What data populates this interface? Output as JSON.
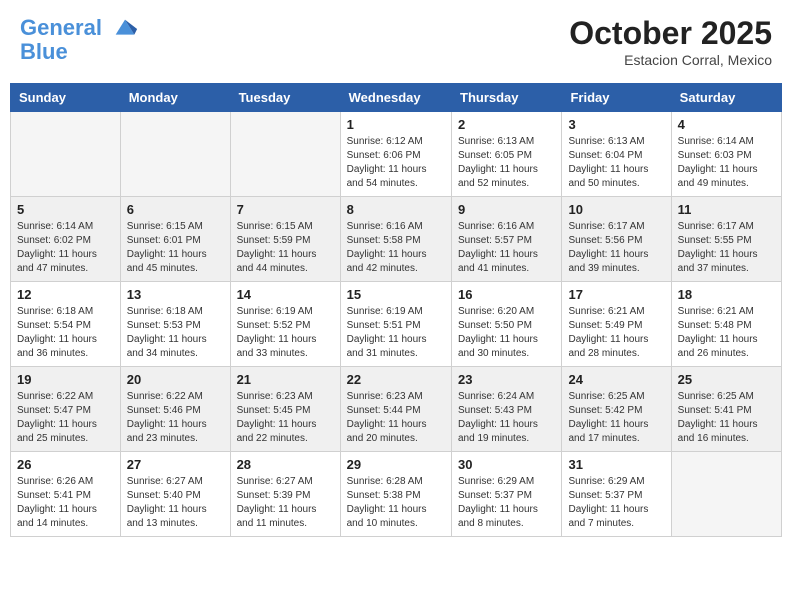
{
  "header": {
    "logo_line1": "General",
    "logo_line2": "Blue",
    "month_title": "October 2025",
    "location": "Estacion Corral, Mexico"
  },
  "weekdays": [
    "Sunday",
    "Monday",
    "Tuesday",
    "Wednesday",
    "Thursday",
    "Friday",
    "Saturday"
  ],
  "weeks": [
    [
      {
        "day": "",
        "sunrise": "",
        "sunset": "",
        "daylight": ""
      },
      {
        "day": "",
        "sunrise": "",
        "sunset": "",
        "daylight": ""
      },
      {
        "day": "",
        "sunrise": "",
        "sunset": "",
        "daylight": ""
      },
      {
        "day": "1",
        "sunrise": "6:12 AM",
        "sunset": "6:06 PM",
        "daylight": "11 hours and 54 minutes."
      },
      {
        "day": "2",
        "sunrise": "6:13 AM",
        "sunset": "6:05 PM",
        "daylight": "11 hours and 52 minutes."
      },
      {
        "day": "3",
        "sunrise": "6:13 AM",
        "sunset": "6:04 PM",
        "daylight": "11 hours and 50 minutes."
      },
      {
        "day": "4",
        "sunrise": "6:14 AM",
        "sunset": "6:03 PM",
        "daylight": "11 hours and 49 minutes."
      }
    ],
    [
      {
        "day": "5",
        "sunrise": "6:14 AM",
        "sunset": "6:02 PM",
        "daylight": "11 hours and 47 minutes."
      },
      {
        "day": "6",
        "sunrise": "6:15 AM",
        "sunset": "6:01 PM",
        "daylight": "11 hours and 45 minutes."
      },
      {
        "day": "7",
        "sunrise": "6:15 AM",
        "sunset": "5:59 PM",
        "daylight": "11 hours and 44 minutes."
      },
      {
        "day": "8",
        "sunrise": "6:16 AM",
        "sunset": "5:58 PM",
        "daylight": "11 hours and 42 minutes."
      },
      {
        "day": "9",
        "sunrise": "6:16 AM",
        "sunset": "5:57 PM",
        "daylight": "11 hours and 41 minutes."
      },
      {
        "day": "10",
        "sunrise": "6:17 AM",
        "sunset": "5:56 PM",
        "daylight": "11 hours and 39 minutes."
      },
      {
        "day": "11",
        "sunrise": "6:17 AM",
        "sunset": "5:55 PM",
        "daylight": "11 hours and 37 minutes."
      }
    ],
    [
      {
        "day": "12",
        "sunrise": "6:18 AM",
        "sunset": "5:54 PM",
        "daylight": "11 hours and 36 minutes."
      },
      {
        "day": "13",
        "sunrise": "6:18 AM",
        "sunset": "5:53 PM",
        "daylight": "11 hours and 34 minutes."
      },
      {
        "day": "14",
        "sunrise": "6:19 AM",
        "sunset": "5:52 PM",
        "daylight": "11 hours and 33 minutes."
      },
      {
        "day": "15",
        "sunrise": "6:19 AM",
        "sunset": "5:51 PM",
        "daylight": "11 hours and 31 minutes."
      },
      {
        "day": "16",
        "sunrise": "6:20 AM",
        "sunset": "5:50 PM",
        "daylight": "11 hours and 30 minutes."
      },
      {
        "day": "17",
        "sunrise": "6:21 AM",
        "sunset": "5:49 PM",
        "daylight": "11 hours and 28 minutes."
      },
      {
        "day": "18",
        "sunrise": "6:21 AM",
        "sunset": "5:48 PM",
        "daylight": "11 hours and 26 minutes."
      }
    ],
    [
      {
        "day": "19",
        "sunrise": "6:22 AM",
        "sunset": "5:47 PM",
        "daylight": "11 hours and 25 minutes."
      },
      {
        "day": "20",
        "sunrise": "6:22 AM",
        "sunset": "5:46 PM",
        "daylight": "11 hours and 23 minutes."
      },
      {
        "day": "21",
        "sunrise": "6:23 AM",
        "sunset": "5:45 PM",
        "daylight": "11 hours and 22 minutes."
      },
      {
        "day": "22",
        "sunrise": "6:23 AM",
        "sunset": "5:44 PM",
        "daylight": "11 hours and 20 minutes."
      },
      {
        "day": "23",
        "sunrise": "6:24 AM",
        "sunset": "5:43 PM",
        "daylight": "11 hours and 19 minutes."
      },
      {
        "day": "24",
        "sunrise": "6:25 AM",
        "sunset": "5:42 PM",
        "daylight": "11 hours and 17 minutes."
      },
      {
        "day": "25",
        "sunrise": "6:25 AM",
        "sunset": "5:41 PM",
        "daylight": "11 hours and 16 minutes."
      }
    ],
    [
      {
        "day": "26",
        "sunrise": "6:26 AM",
        "sunset": "5:41 PM",
        "daylight": "11 hours and 14 minutes."
      },
      {
        "day": "27",
        "sunrise": "6:27 AM",
        "sunset": "5:40 PM",
        "daylight": "11 hours and 13 minutes."
      },
      {
        "day": "28",
        "sunrise": "6:27 AM",
        "sunset": "5:39 PM",
        "daylight": "11 hours and 11 minutes."
      },
      {
        "day": "29",
        "sunrise": "6:28 AM",
        "sunset": "5:38 PM",
        "daylight": "11 hours and 10 minutes."
      },
      {
        "day": "30",
        "sunrise": "6:29 AM",
        "sunset": "5:37 PM",
        "daylight": "11 hours and 8 minutes."
      },
      {
        "day": "31",
        "sunrise": "6:29 AM",
        "sunset": "5:37 PM",
        "daylight": "11 hours and 7 minutes."
      },
      {
        "day": "",
        "sunrise": "",
        "sunset": "",
        "daylight": ""
      }
    ]
  ],
  "labels": {
    "sunrise_prefix": "Sunrise: ",
    "sunset_prefix": "Sunset: ",
    "daylight_label": "Daylight hours"
  }
}
